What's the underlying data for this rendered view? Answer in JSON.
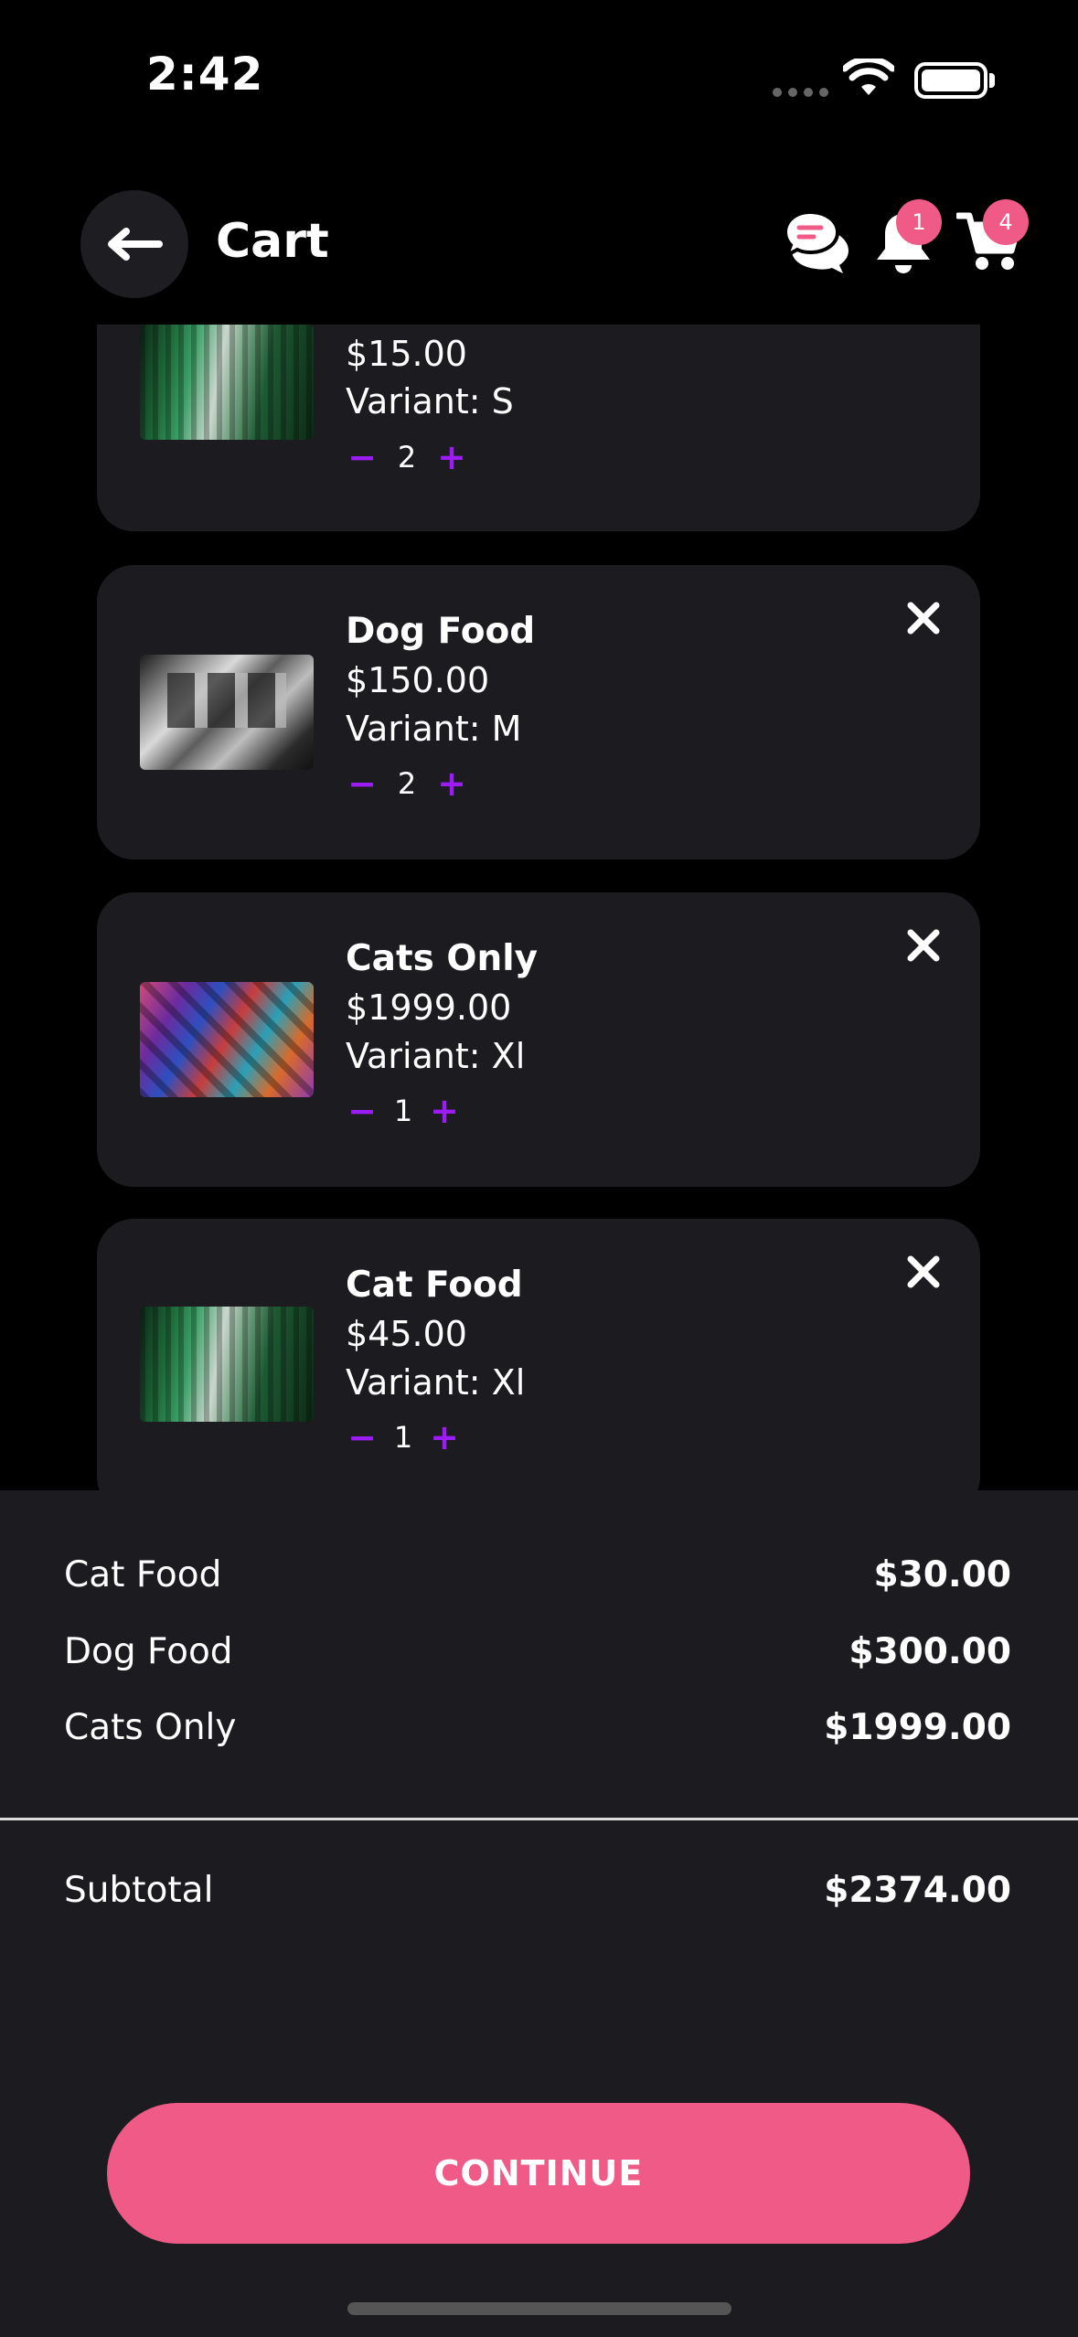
{
  "status_bar": {
    "time": "2:42"
  },
  "header": {
    "title": "Cart",
    "notifications_count": "1",
    "cart_count": "4"
  },
  "cart_items": [
    {
      "name": "",
      "price": "$15.00",
      "variant": "Variant: S",
      "quantity": "2"
    },
    {
      "name": "Dog Food",
      "price": "$150.00",
      "variant": "Variant: M",
      "quantity": "2"
    },
    {
      "name": "Cats Only",
      "price": "$1999.00",
      "variant": "Variant: Xl",
      "quantity": "1"
    },
    {
      "name": "Cat Food",
      "price": "$45.00",
      "variant": "Variant: Xl",
      "quantity": "1"
    }
  ],
  "qty_controls": {
    "minus": "−",
    "plus": "+"
  },
  "summary": {
    "lines": [
      {
        "label": "Cat Food",
        "amount": "$30.00"
      },
      {
        "label": "Dog Food",
        "amount": "$300.00"
      },
      {
        "label": "Cats Only",
        "amount": "$1999.00"
      }
    ],
    "subtotal_label": "Subtotal",
    "subtotal_amount": "$2374.00"
  },
  "continue_label": "CONTINUE",
  "colors": {
    "accent": "#ef5b86",
    "qty": "#9b1cf5",
    "card": "#1c1b1f",
    "background": "#000000"
  }
}
